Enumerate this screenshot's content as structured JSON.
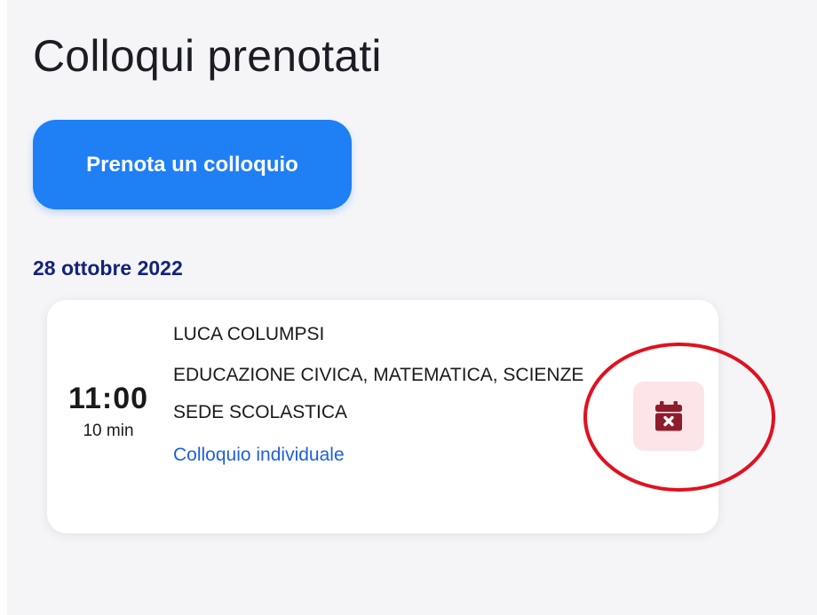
{
  "page": {
    "title": "Colloqui prenotati",
    "book_button_label": "Prenota un colloquio"
  },
  "day_group": {
    "date": "28 ottobre 2022"
  },
  "appointment": {
    "time": "11:00",
    "duration": "10 min",
    "teacher": "LUCA COLUMPSI",
    "subjects": "EDUCAZIONE CIVICA, MATEMATICA, SCIENZE",
    "location": "SEDE SCOLASTICA",
    "meeting_type": "Colloquio individuale",
    "cancel_icon": "calendar-x-icon"
  },
  "colors": {
    "accent": "#1f7ff5",
    "date_heading": "#13237a",
    "link": "#1f5fe0",
    "cancel_icon": "#8e1c2b",
    "cancel_bg": "#fde4e8",
    "annotation": "#e0111f"
  }
}
